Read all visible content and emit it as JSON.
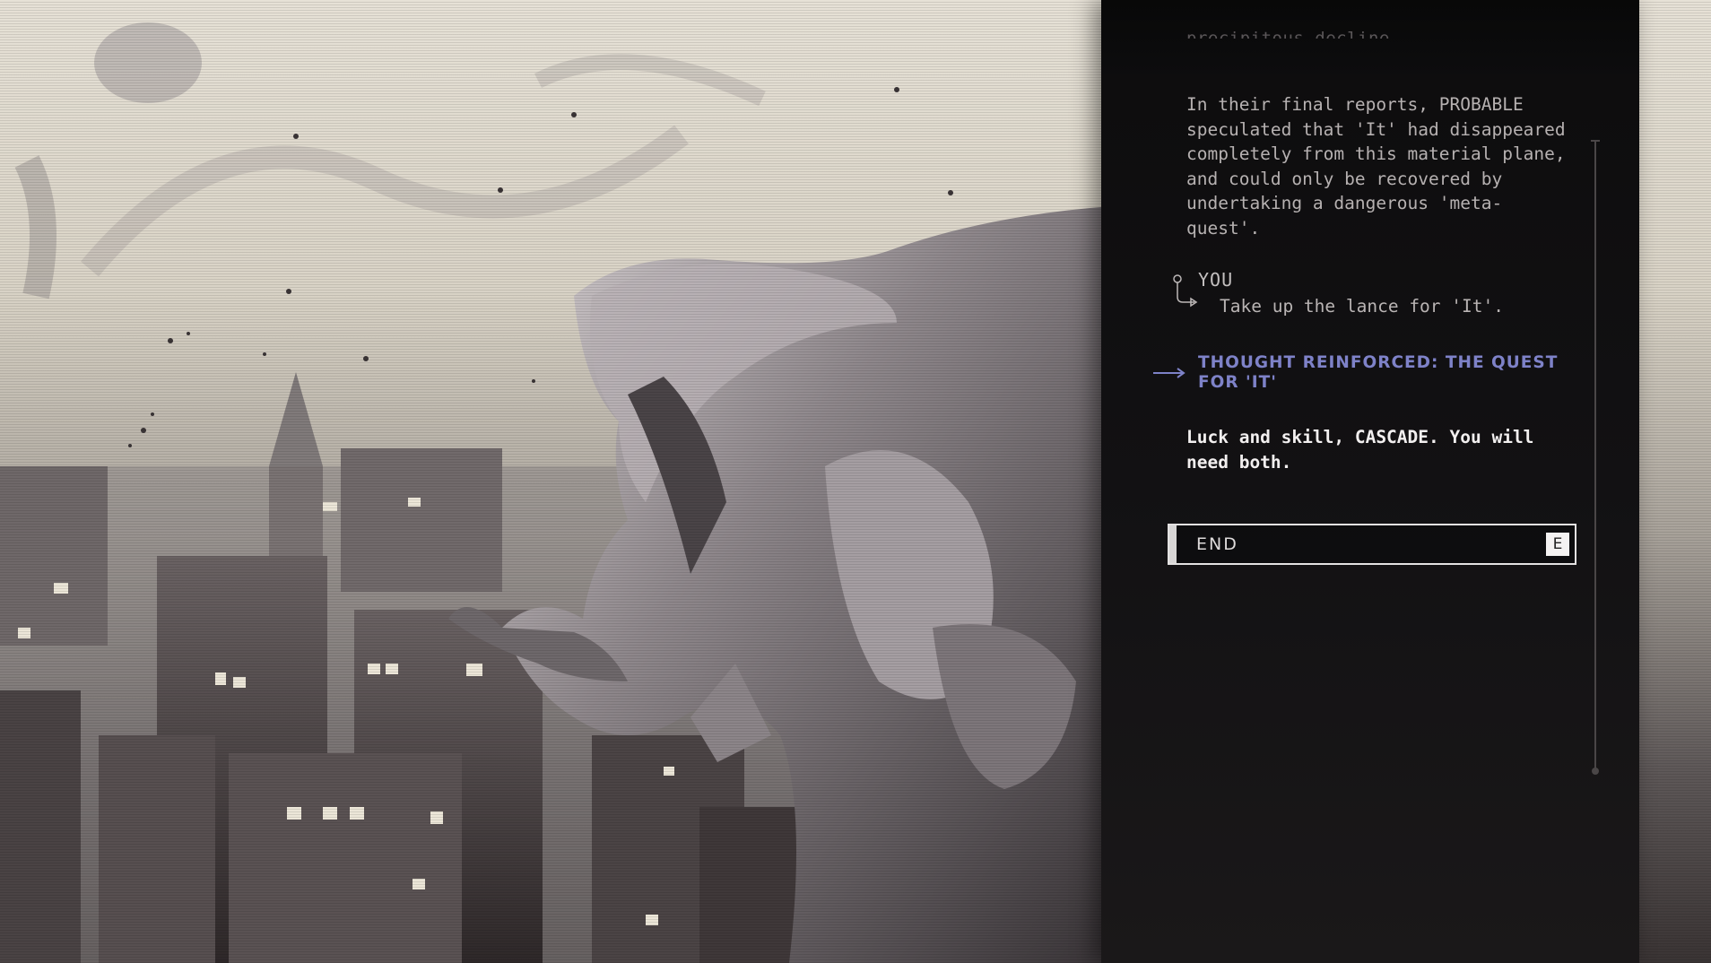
{
  "dialog": {
    "faded_top_line": "precipitous decline.",
    "narrative": "In their final reports, PROBABLE\nspeculated that 'It' had disappeared\ncompletely from this material plane,\nand could only be recovered by\nundertaking a dangerous 'meta-\nquest'.",
    "you": {
      "label": "YOU",
      "choice": "Take up the lance for 'It'."
    },
    "thought": "THOUGHT REINFORCED: THE QUEST FOR 'IT'",
    "reply": "Luck and skill, CASCADE. You will need both.",
    "end_button": {
      "label": "END",
      "key": "E"
    }
  },
  "icons": {
    "you_branch": "branch-arrow-icon",
    "thought_arrow": "long-arrow-right-icon"
  },
  "colors": {
    "thought_accent": "#7e82c8",
    "panel_background": "#121113",
    "reply_text": "#f2efef"
  }
}
